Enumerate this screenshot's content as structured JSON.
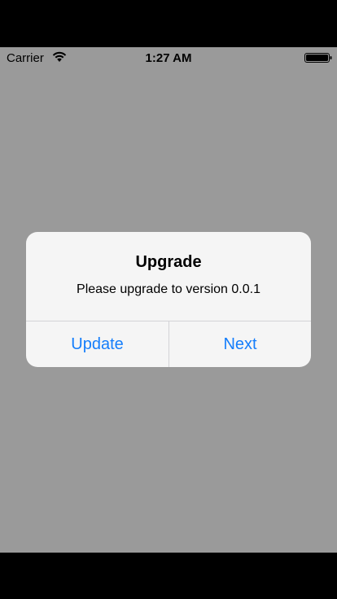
{
  "status_bar": {
    "carrier": "Carrier",
    "time": "1:27 AM",
    "wifi_icon": "wifi-icon",
    "battery_icon": "battery-icon"
  },
  "alert": {
    "title": "Upgrade",
    "message": "Please upgrade to version 0.0.1",
    "buttons": [
      {
        "label": "Update"
      },
      {
        "label": "Next"
      }
    ]
  },
  "colors": {
    "overlay": "#9a9a9a",
    "alert_background": "#f5f5f5",
    "button_tint": "#157efb",
    "bezel": "#000000"
  }
}
